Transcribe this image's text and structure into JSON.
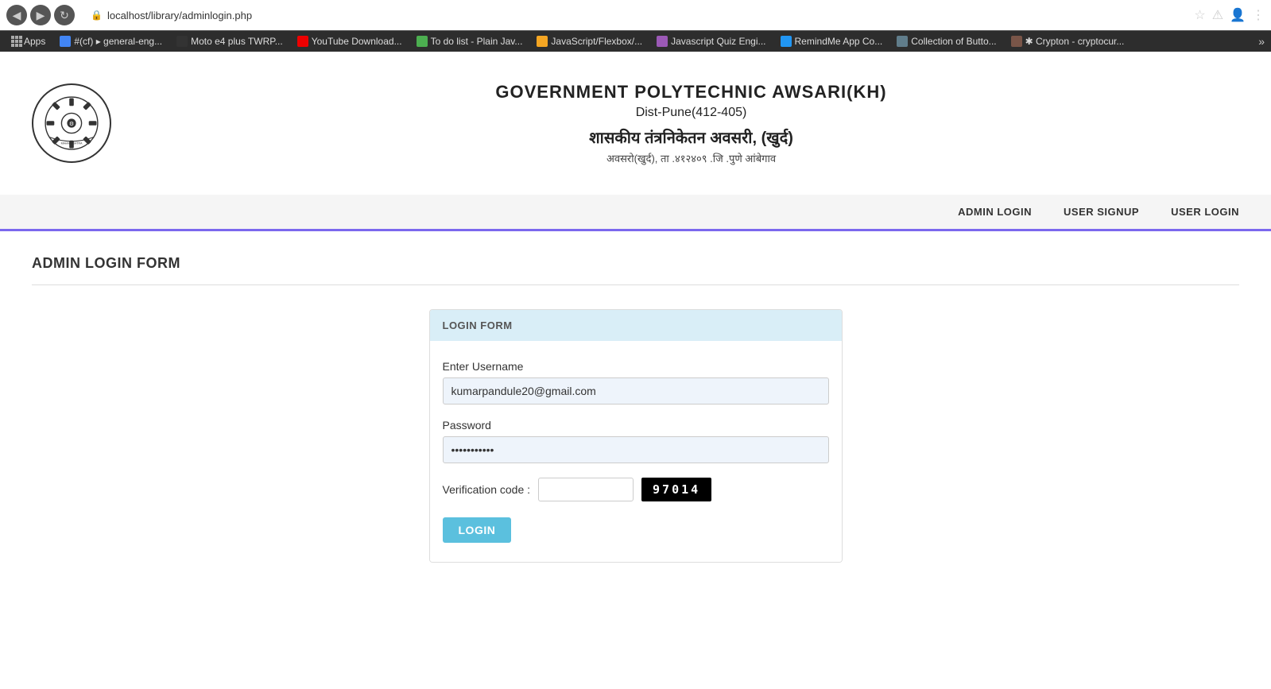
{
  "browser": {
    "url": "localhost/library/adminlogin.php",
    "nav_back_label": "◀",
    "nav_forward_label": "▶",
    "nav_refresh_label": "↻",
    "toolbar_icons": [
      "★",
      "⚠",
      "👤",
      "⋮"
    ]
  },
  "bookmarks": {
    "apps_label": "Apps",
    "items": [
      {
        "id": "bm1",
        "label": "#(cf) ▸ general-eng...",
        "color": "#4285f4"
      },
      {
        "id": "bm2",
        "label": "Moto e4 plus TWRP...",
        "color": "#333"
      },
      {
        "id": "bm3",
        "label": "YouTube Download...",
        "color": "#e00"
      },
      {
        "id": "bm4",
        "label": "To do list - Plain Jav...",
        "color": "#4caf50"
      },
      {
        "id": "bm5",
        "label": "JavaScript/Flexbox/...",
        "color": "#f5a623"
      },
      {
        "id": "bm6",
        "label": "Javascript Quiz Engi...",
        "color": "#9b59b6"
      },
      {
        "id": "bm7",
        "label": "RemindMe App Co...",
        "color": "#2196f3"
      },
      {
        "id": "bm8",
        "label": "Collection of Butto...",
        "color": "#607d8b"
      },
      {
        "id": "bm9",
        "label": "Crypton - cryptocur...",
        "color": "#795548"
      }
    ],
    "more_label": "»"
  },
  "header": {
    "institution_name": "GOVERNMENT POLYTECHNIC AWSARI(KH)",
    "district": "Dist-Pune(412-405)",
    "marathi_name": "शासकीय तंत्रनिकेतन अवसरी, (खुर्द)",
    "marathi_address": "अवसरो(खुर्द), ता .४१२४०९ .जि .पुणे  आंबेगाव"
  },
  "nav": {
    "links": [
      {
        "id": "admin-login",
        "label": "ADMIN LOGIN"
      },
      {
        "id": "user-signup",
        "label": "USER SIGNUP"
      },
      {
        "id": "user-login",
        "label": "USER LOGIN"
      }
    ]
  },
  "main": {
    "page_title": "ADMIN LOGIN FORM",
    "form": {
      "card_header": "LOGIN FORM",
      "username_label": "Enter Username",
      "username_value": "kumarpandule20@gmail.com",
      "username_placeholder": "Enter Username",
      "password_label": "Password",
      "password_value": "••••••••",
      "verification_label": "Verification code :",
      "verification_placeholder": "",
      "captcha_value": "97014",
      "login_button_label": "LOGIN"
    }
  }
}
